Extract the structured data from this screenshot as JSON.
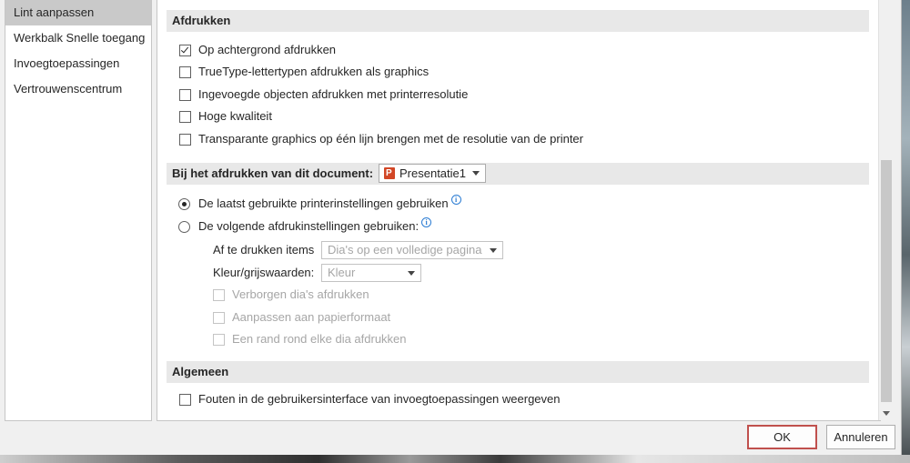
{
  "nav": {
    "items": [
      {
        "label": "Lint aanpassen",
        "selected": true
      },
      {
        "label": "Werkbalk Snelle toegang",
        "selected": false
      },
      {
        "label": "Invoegtoepassingen",
        "selected": false
      },
      {
        "label": "Vertrouwenscentrum",
        "selected": false
      }
    ]
  },
  "print_section": {
    "header": "Afdrukken",
    "options": [
      {
        "label": "Op achtergrond afdrukken",
        "checked": true
      },
      {
        "label": "TrueType-lettertypen afdrukken als graphics",
        "checked": false
      },
      {
        "label": "Ingevoegde objecten afdrukken met printerresolutie",
        "checked": false
      },
      {
        "label": "Hoge kwaliteit",
        "checked": false
      },
      {
        "label": "Transparante graphics op één lijn brengen met de resolutie van de printer",
        "checked": false
      }
    ]
  },
  "document_section": {
    "header": "Bij het afdrukken van dit document:",
    "document": "Presentatie1",
    "radio_last": "De laatst gebruikte printerinstellingen gebruiken",
    "radio_following": "De volgende afdrukinstellingen gebruiken:",
    "print_items_label": "Af te drukken items",
    "print_items_value": "Dia's op een volledige pagina",
    "color_label": "Kleur/grijswaarden:",
    "color_value": "Kleur",
    "sub_options": [
      "Verborgen dia's afdrukken",
      "Aanpassen aan papierformaat",
      "Een rand rond elke dia afdrukken"
    ]
  },
  "general_section": {
    "header": "Algemeen",
    "option": "Fouten in de gebruikersinterface van invoegtoepassingen weergeven"
  },
  "buttons": {
    "ok": "OK",
    "cancel": "Annuleren"
  },
  "colors": {
    "accent_ok_border": "#c0504d",
    "ppt_icon": "#d24726",
    "info_icon": "#2b7cd3"
  }
}
